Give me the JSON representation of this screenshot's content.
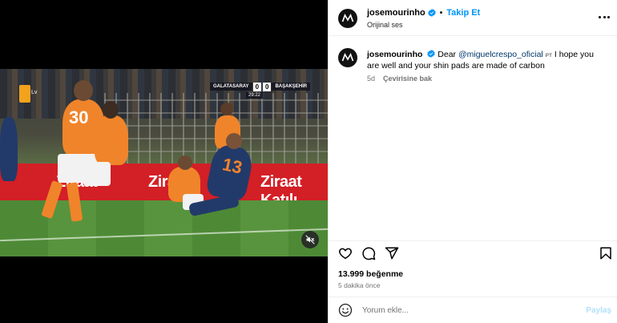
{
  "post": {
    "username": "josemourinho",
    "follow_label": "Takip Et",
    "dot": "•",
    "audio_label": "Orijinal ses"
  },
  "caption": {
    "username": "josemourinho",
    "text_before": "Dear",
    "mention": "@miguelcrespo_oficial",
    "tag": "PT",
    "text_after": "I hope you are well and your shin pads are made of carbon",
    "age": "5d",
    "translate_label": "Çevirisine bak"
  },
  "stats": {
    "likes": "13.999 beğenme",
    "time_ago": "5 dakika önce"
  },
  "comment_input": {
    "placeholder": "Yorum ekle...",
    "share_label": "Paylaş"
  },
  "video": {
    "home_team": "GALATASARAY",
    "home_score": "0",
    "away_score": "0",
    "away_team": "BAŞAKŞEHİR",
    "clock": "29:22",
    "channel": "Lv",
    "banner_text_1": "Ziraat",
    "banner_text_2": "Ziraat Katılı",
    "number_left": "30",
    "number_right": "13"
  },
  "colors": {
    "accent": "#0095f6",
    "banner": "#d31f26",
    "muted": "#737373"
  },
  "icons": [
    "verified-badge-icon",
    "more-options-icon",
    "heart-icon",
    "comment-icon",
    "share-icon",
    "bookmark-icon",
    "emoji-icon",
    "mute-icon"
  ]
}
